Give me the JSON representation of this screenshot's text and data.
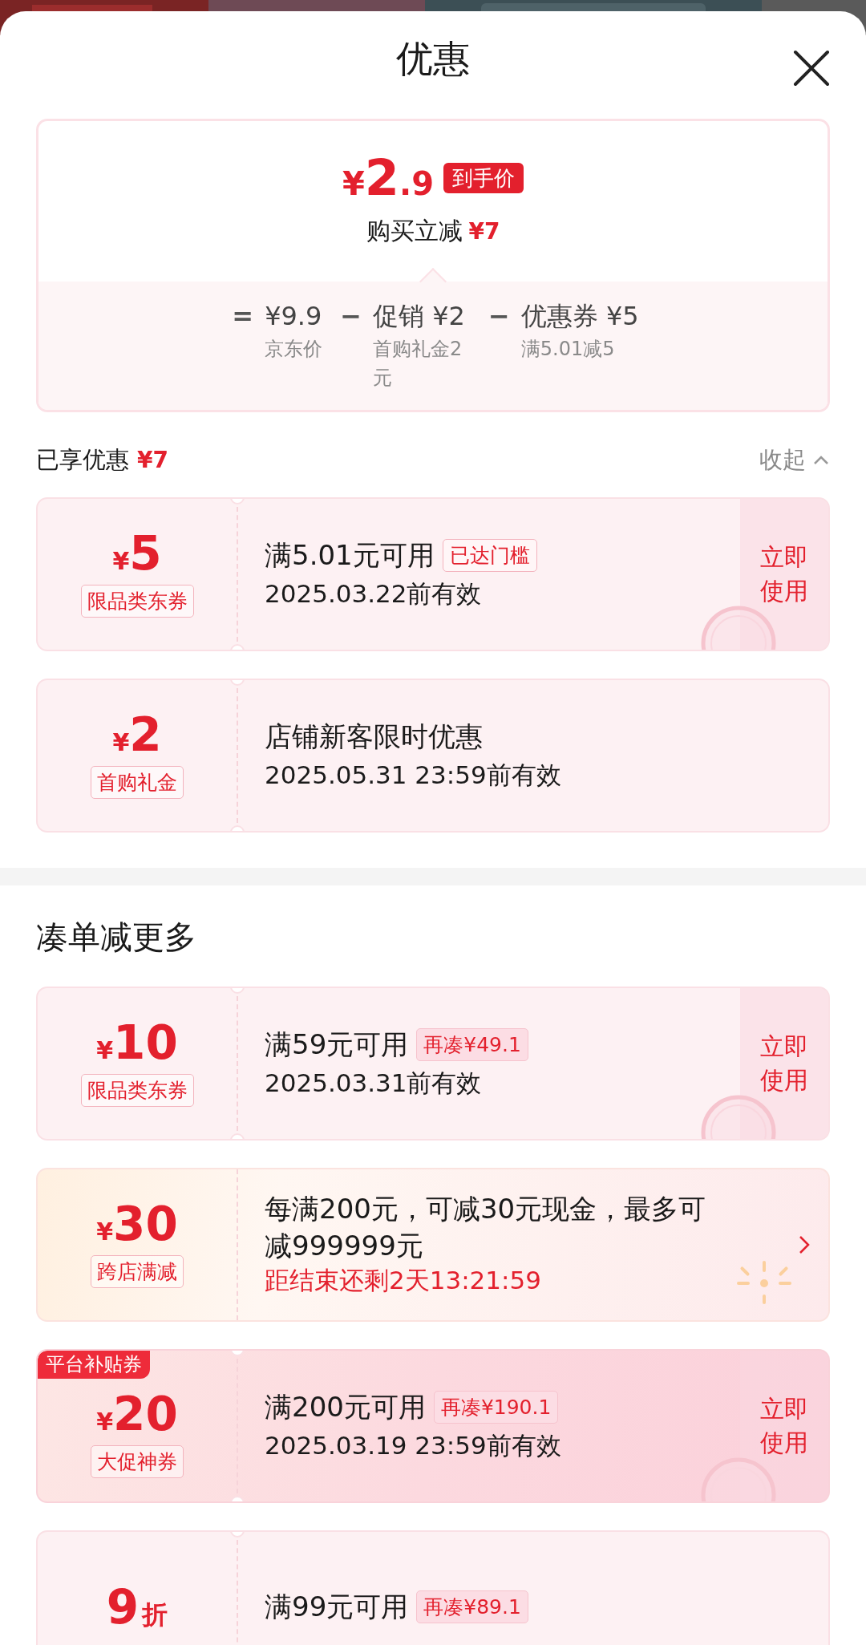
{
  "sheet": {
    "title": "优惠"
  },
  "summary": {
    "currency": "¥",
    "price_int": "2",
    "price_dec": ".9",
    "price_badge": "到手价",
    "saving_label": "购买立减",
    "saving_value": "¥7",
    "terms": [
      {
        "op": "=",
        "value": "¥9.9",
        "note": "京东价"
      },
      {
        "op": "−",
        "value": "促销 ¥2",
        "note": "首购礼金2元"
      },
      {
        "op": "−",
        "value": "优惠券 ¥5",
        "note": "满5.01减5"
      }
    ]
  },
  "enjoyed": {
    "label": "已享优惠",
    "value": "¥7",
    "toggle": "收起",
    "expanded": true
  },
  "enjoyed_coupons": [
    {
      "kind": "voucher",
      "prefix": "¥",
      "amount": "5",
      "tag": "限品类东券",
      "title": "满5.01元可用",
      "chip": {
        "text": "已达门槛",
        "kind": "reached"
      },
      "date": "2025.03.22前有效",
      "action": "立即使用",
      "claimed": true
    },
    {
      "kind": "voucher",
      "prefix": "¥",
      "amount": "2",
      "tag": "首购礼金",
      "title": "店铺新客限时优惠",
      "date": "2025.05.31 23:59前有效",
      "claimed": false
    }
  ],
  "more": {
    "title": "凑单减更多"
  },
  "more_coupons": [
    {
      "kind": "voucher",
      "prefix": "¥",
      "amount": "10",
      "tag": "限品类东券",
      "title": "满59元可用",
      "chip": {
        "text": "再凑¥49.1",
        "kind": "gap"
      },
      "date": "2025.03.31前有效",
      "action": "立即使用",
      "claimed": true
    },
    {
      "kind": "promo",
      "prefix": "¥",
      "amount": "30",
      "tag": "跨店满减",
      "title": "每满200元，可减30元现金，最多可减999999元",
      "countdown": "距结束还剩2天13:21:59",
      "claimed": false
    },
    {
      "kind": "subsidy",
      "corner_label": "平台补贴券",
      "prefix": "¥",
      "amount": "20",
      "tag": "大促神券",
      "title": "满200元可用",
      "chip": {
        "text": "再凑¥190.1",
        "kind": "gap"
      },
      "date": "2025.03.19 23:59前有效",
      "action": "立即使用",
      "claimed": true
    },
    {
      "kind": "voucher",
      "amount": "9",
      "suffix": "折",
      "title": "满99元可用",
      "chip": {
        "text": "再凑¥89.1",
        "kind": "gap"
      },
      "claimed": false
    }
  ]
}
